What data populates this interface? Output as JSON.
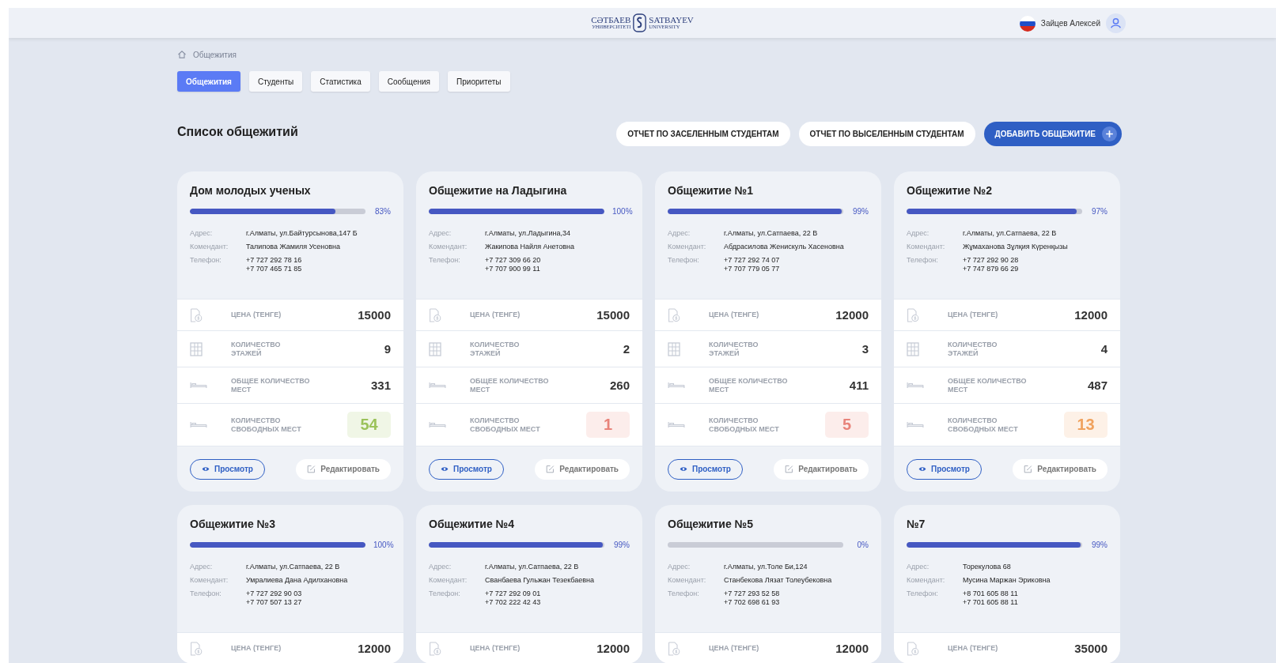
{
  "header": {
    "logo": {
      "left_top": "СӘТБАЕВ",
      "left_bottom": "УНИВЕРСИТЕТІ",
      "right_top": "SATBAYEV",
      "right_bottom": "UNIVERSITY"
    },
    "user_name": "Зайцев Алексей"
  },
  "breadcrumb": [
    "Общежития"
  ],
  "tabs": [
    {
      "label": "Общежития",
      "selected": true
    },
    {
      "label": "Студенты",
      "selected": false
    },
    {
      "label": "Статистика",
      "selected": false
    },
    {
      "label": "Сообщения",
      "selected": false
    },
    {
      "label": "Приоритеты",
      "selected": false
    }
  ],
  "page_title": "Список общежитий",
  "actions": [
    {
      "label": "ОТЧЕТ ПО ЗАСЕЛЕННЫМ СТУДЕНТАМ",
      "kind": "secondary"
    },
    {
      "label": "ОТЧЕТ ПО ВЫСЕЛЕННЫМ СТУДЕНТАМ",
      "kind": "secondary"
    },
    {
      "label": "ДОБАВИТЬ ОБЩЕЖИТИЕ",
      "kind": "primary"
    }
  ],
  "dormitories": [
    {
      "name": "Дом молодых ученых",
      "level": 0.83,
      "percent": "83%",
      "info": [
        {
          "label": "Адрес:",
          "lines": [
            "г.Алматы, ул.Байтурсынова,147 Б"
          ]
        },
        {
          "label": "Комендант:",
          "lines": [
            "Талипова Жамиля Усеновна"
          ]
        },
        {
          "label": "Телефон:",
          "lines": [
            "+7 727 292 78 16",
            "+7 707 465 71 85"
          ]
        }
      ],
      "stats": [
        {
          "kind": "price",
          "label": [
            "ЦЕНА (ТЕНГЕ)"
          ],
          "value": "15000"
        },
        {
          "kind": "floors",
          "label": [
            "КОЛИЧЕСТВО",
            "ЭТАЖЕЙ"
          ],
          "value": "9"
        },
        {
          "kind": "beds",
          "label": [
            "ОБЩЕЕ КОЛИЧЕСТВО",
            "МЕСТ"
          ],
          "value": "331"
        },
        {
          "kind": "free",
          "label": [
            "КОЛИЧЕСТВО",
            "СВОБОДНЫХ МЕСТ"
          ],
          "value": "54",
          "color": "#9bc25a"
        }
      ],
      "buttons": [
        "Просмотр",
        "Редактировать"
      ]
    },
    {
      "name": "Общежитие на Ладыгина",
      "level": 1,
      "percent": "100%",
      "info": [
        {
          "label": "Адрес:",
          "lines": [
            "г.Алматы, ул.Ладыгина,34"
          ]
        },
        {
          "label": "Комендант:",
          "lines": [
            "Жакипова Найля Анетовна"
          ]
        },
        {
          "label": "Телефон:",
          "lines": [
            "+7 727 309 66 20",
            "+7 707 900 99 11"
          ]
        }
      ],
      "stats": [
        {
          "kind": "price",
          "label": [
            "ЦЕНА (ТЕНГЕ)"
          ],
          "value": "15000"
        },
        {
          "kind": "floors",
          "label": [
            "КОЛИЧЕСТВО",
            "ЭТАЖЕЙ"
          ],
          "value": "2"
        },
        {
          "kind": "beds",
          "label": [
            "ОБЩЕЕ КОЛИЧЕСТВО",
            "МЕСТ"
          ],
          "value": "260"
        },
        {
          "kind": "free",
          "label": [
            "КОЛИЧЕСТВО",
            "СВОБОДНЫХ МЕСТ"
          ],
          "value": "1",
          "color": "#e8837a"
        }
      ],
      "buttons": [
        "Просмотр",
        "Редактировать"
      ]
    },
    {
      "name": "Общежитие №1",
      "level": 0.99,
      "percent": "99%",
      "info": [
        {
          "label": "Адрес:",
          "lines": [
            "г.Алматы, ул.Сатпаева, 22 В"
          ]
        },
        {
          "label": "Комендант:",
          "lines": [
            "Абдрасилова Женискуль Хасеновна"
          ]
        },
        {
          "label": "Телефон:",
          "lines": [
            "+7 727 292 74 07",
            "+7 707 779 05 77"
          ]
        }
      ],
      "stats": [
        {
          "kind": "price",
          "label": [
            "ЦЕНА (ТЕНГЕ)"
          ],
          "value": "12000"
        },
        {
          "kind": "floors",
          "label": [
            "КОЛИЧЕСТВО",
            "ЭТАЖЕЙ"
          ],
          "value": "3"
        },
        {
          "kind": "beds",
          "label": [
            "ОБЩЕЕ КОЛИЧЕСТВО",
            "МЕСТ"
          ],
          "value": "411"
        },
        {
          "kind": "free",
          "label": [
            "КОЛИЧЕСТВО",
            "СВОБОДНЫХ МЕСТ"
          ],
          "value": "5",
          "color": "#e8837a"
        }
      ],
      "buttons": [
        "Просмотр",
        "Редактировать"
      ]
    },
    {
      "name": "Общежитие №2",
      "level": 0.97,
      "percent": "97%",
      "info": [
        {
          "label": "Адрес:",
          "lines": [
            "г.Алматы, ул.Сатпаева, 22 В"
          ]
        },
        {
          "label": "Комендант:",
          "lines": [
            "Жұмаханова Зұлқия Күренқызы"
          ]
        },
        {
          "label": "Телефон:",
          "lines": [
            "+7 727 292 90 28",
            "+7 747 879 66 29"
          ]
        }
      ],
      "stats": [
        {
          "kind": "price",
          "label": [
            "ЦЕНА (ТЕНГЕ)"
          ],
          "value": "12000"
        },
        {
          "kind": "floors",
          "label": [
            "КОЛИЧЕСТВО",
            "ЭТАЖЕЙ"
          ],
          "value": "4"
        },
        {
          "kind": "beds",
          "label": [
            "ОБЩЕЕ КОЛИЧЕСТВО",
            "МЕСТ"
          ],
          "value": "487"
        },
        {
          "kind": "free",
          "label": [
            "КОЛИЧЕСТВО",
            "СВОБОДНЫХ МЕСТ"
          ],
          "value": "13",
          "color": "#f0a25e"
        }
      ],
      "buttons": [
        "Просмотр",
        "Редактировать"
      ]
    },
    {
      "name": "Общежитие №3",
      "level": 1,
      "percent": "100%",
      "info": [
        {
          "label": "Адрес:",
          "lines": [
            "г.Алматы, ул.Сатпаева, 22 В"
          ]
        },
        {
          "label": "Комендант:",
          "lines": [
            "Умралиева Дана Адилхановна"
          ]
        },
        {
          "label": "Телефон:",
          "lines": [
            "+7 727 292 90 03",
            "+7 707 507 13 27"
          ]
        }
      ],
      "stats": [
        {
          "kind": "price",
          "label": [
            "ЦЕНА (ТЕНГЕ)"
          ],
          "value": "12000"
        }
      ]
    },
    {
      "name": "Общежитие №4",
      "level": 0.99,
      "percent": "99%",
      "info": [
        {
          "label": "Адрес:",
          "lines": [
            "г.Алматы, ул.Сатпаева, 22 В"
          ]
        },
        {
          "label": "Комендант:",
          "lines": [
            "Сванбаева Гульжан Тезекбаевна"
          ]
        },
        {
          "label": "Телефон:",
          "lines": [
            "+7 727 292 09 01",
            "+7 702 222 42 43"
          ]
        }
      ],
      "stats": [
        {
          "kind": "price",
          "label": [
            "ЦЕНА (ТЕНГЕ)"
          ],
          "value": "12000"
        }
      ]
    },
    {
      "name": "Общежитие №5",
      "level": 0,
      "percent": "0%",
      "info": [
        {
          "label": "Адрес:",
          "lines": [
            "г.Алматы, ул.Толе Би,124"
          ]
        },
        {
          "label": "Комендант:",
          "lines": [
            "Станбекова Лязат Толеубековна"
          ]
        },
        {
          "label": "Телефон:",
          "lines": [
            "+7 727 293 52 58",
            "+7 702 698 61 93"
          ]
        }
      ],
      "stats": [
        {
          "kind": "price",
          "label": [
            "ЦЕНА (ТЕНГЕ)"
          ],
          "value": "12000"
        }
      ]
    },
    {
      "name": "№7",
      "level": 0.99,
      "percent": "99%",
      "info": [
        {
          "label": "Адрес:",
          "lines": [
            "Торекулова 68"
          ]
        },
        {
          "label": "Комендант:",
          "lines": [
            "Мусина Маржан Эриковна"
          ]
        },
        {
          "label": "Телефон:",
          "lines": [
            "+8 701 605 88 11",
            "+7 701 605 88 11"
          ]
        }
      ],
      "stats": [
        {
          "kind": "price",
          "label": [
            "ЦЕНА (ТЕНГЕ)"
          ],
          "value": "35000"
        }
      ]
    }
  ]
}
